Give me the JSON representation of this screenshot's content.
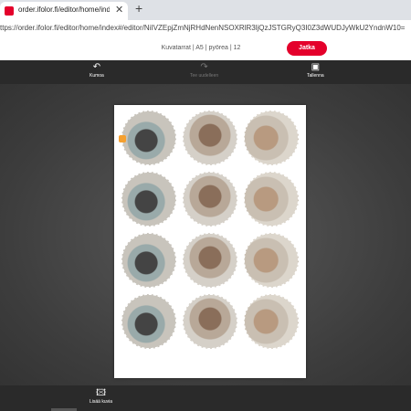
{
  "browser": {
    "tab_title": "order.ifolor.fi/editor/home/index",
    "tab_close": "✕",
    "new_tab": "+",
    "url": "ttps://order.ifolor.fi/editor/home/index#/editor/NiIVZEpjZmNjRHdNenNSOXRlR3ljQzJSTGRyQ3I0Z3dWUDJyWkU2YndnW10="
  },
  "header": {
    "product_info": "Kuvatarrat | A5 | pyörea | 12",
    "continue_label": "Jatka"
  },
  "toolbar": {
    "undo_label": "Kumoa",
    "undo_icon": "undo-icon",
    "redo_label": "Tee uudelleen",
    "redo_icon": "redo-icon",
    "save_label": "Tallenna",
    "save_icon": "save-icon"
  },
  "bottom": {
    "add_image_label": "Lisää kuvia",
    "add_image_icon": "image-icon"
  },
  "colors": {
    "accent": "#e4002b",
    "toolbar_bg": "#2a2a2a"
  }
}
